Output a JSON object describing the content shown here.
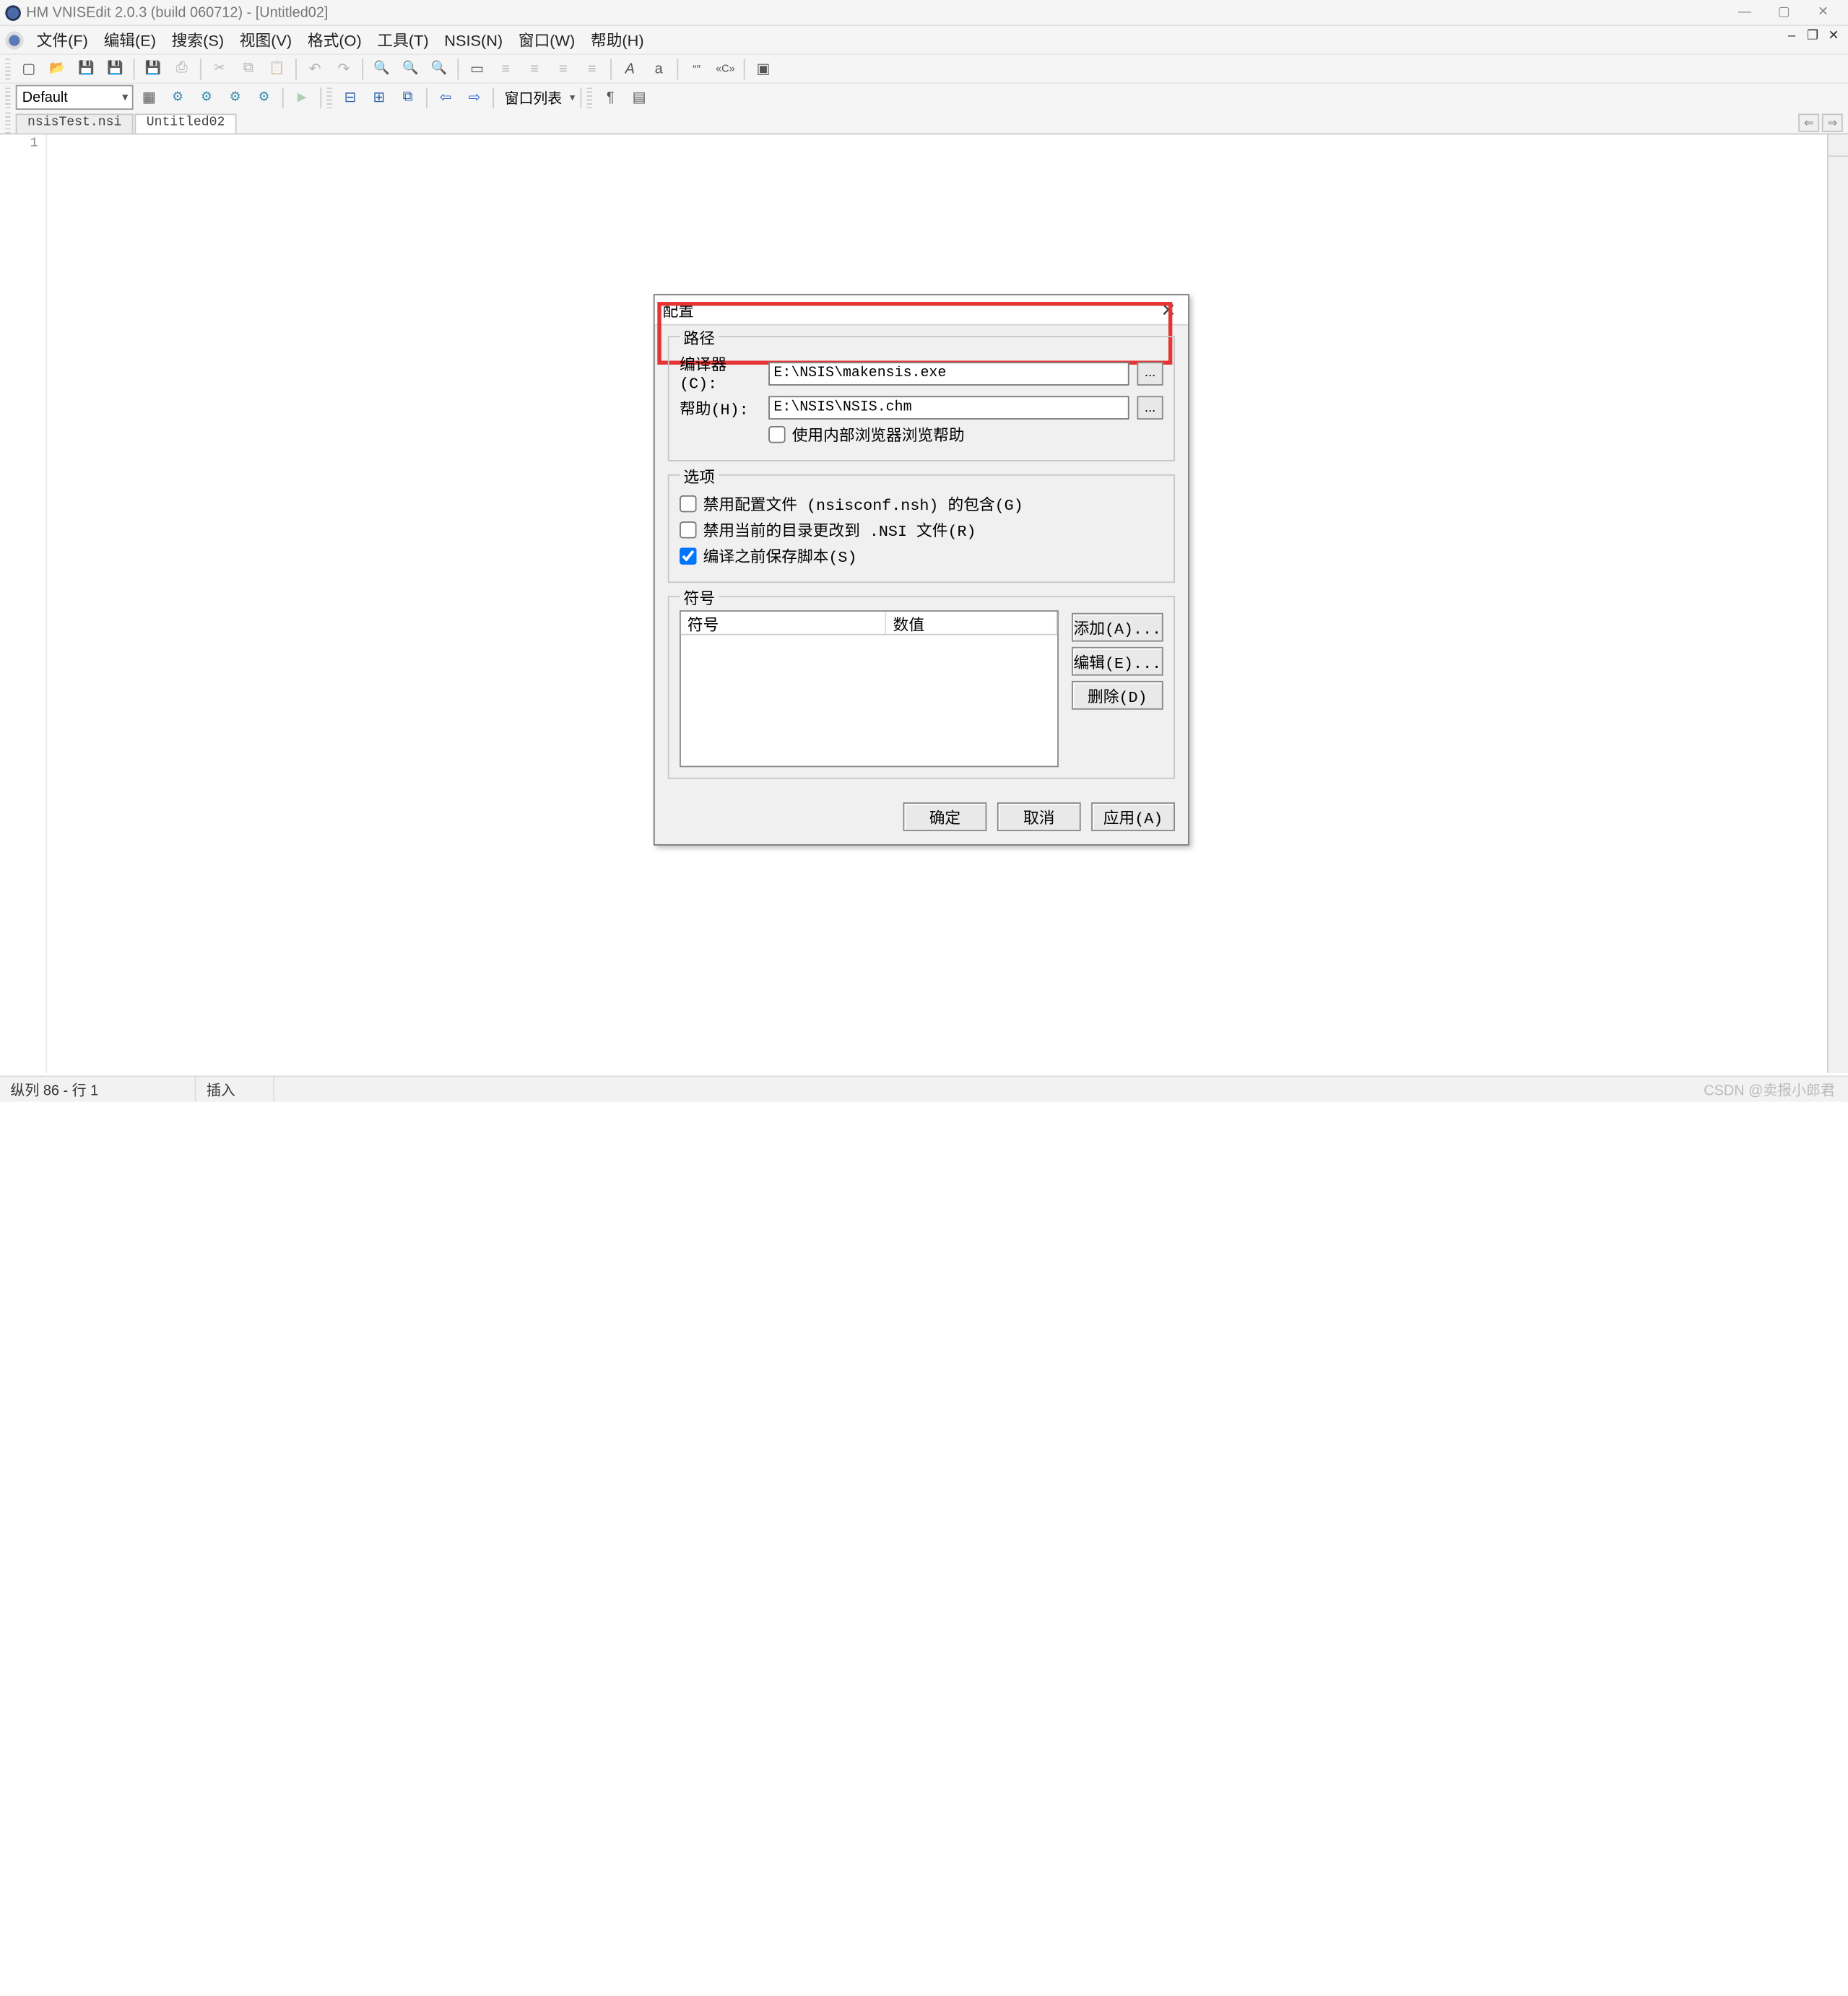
{
  "window": {
    "title": "HM VNISEdit 2.0.3 (build 060712) - [Untitled02]"
  },
  "menu": {
    "file": "文件(F)",
    "edit": "编辑(E)",
    "search": "搜索(S)",
    "view": "视图(V)",
    "format": "格式(O)",
    "tools": "工具(T)",
    "nsis": "NSIS(N)",
    "window": "窗口(W)",
    "help": "帮助(H)"
  },
  "toolbar": {
    "combo_default": "Default",
    "window_list": "窗口列表"
  },
  "tabs": {
    "t0": "nsisTest.nsi",
    "t1": "Untitled02"
  },
  "editor": {
    "line1": "1"
  },
  "status": {
    "pos": "纵列 86 - 行 1",
    "mode": "插入"
  },
  "watermark": "CSDN @卖报小郎君",
  "dialog": {
    "title": "配置",
    "group_path": "路径",
    "label_compiler": "编译器(C):",
    "label_help": "帮助(H):",
    "value_compiler": "E:\\NSIS\\makensis.exe",
    "value_help": "E:\\NSIS\\NSIS.chm",
    "browse": "...",
    "chk_internal_browser": "使用内部浏览器浏览帮助",
    "group_options": "选项",
    "chk_disable_conf": "禁用配置文件 (nsisconf.nsh) 的包含(G)",
    "chk_disable_cd": "禁用当前的目录更改到 .NSI 文件(R)",
    "chk_save_before": "编译之前保存脚本(S)",
    "group_symbols": "符号",
    "col_symbol": "符号",
    "col_value": "数值",
    "btn_add": "添加(A)...",
    "btn_edit": "编辑(E)...",
    "btn_delete": "删除(D)",
    "btn_ok": "确定",
    "btn_cancel": "取消",
    "btn_apply": "应用(A)"
  }
}
